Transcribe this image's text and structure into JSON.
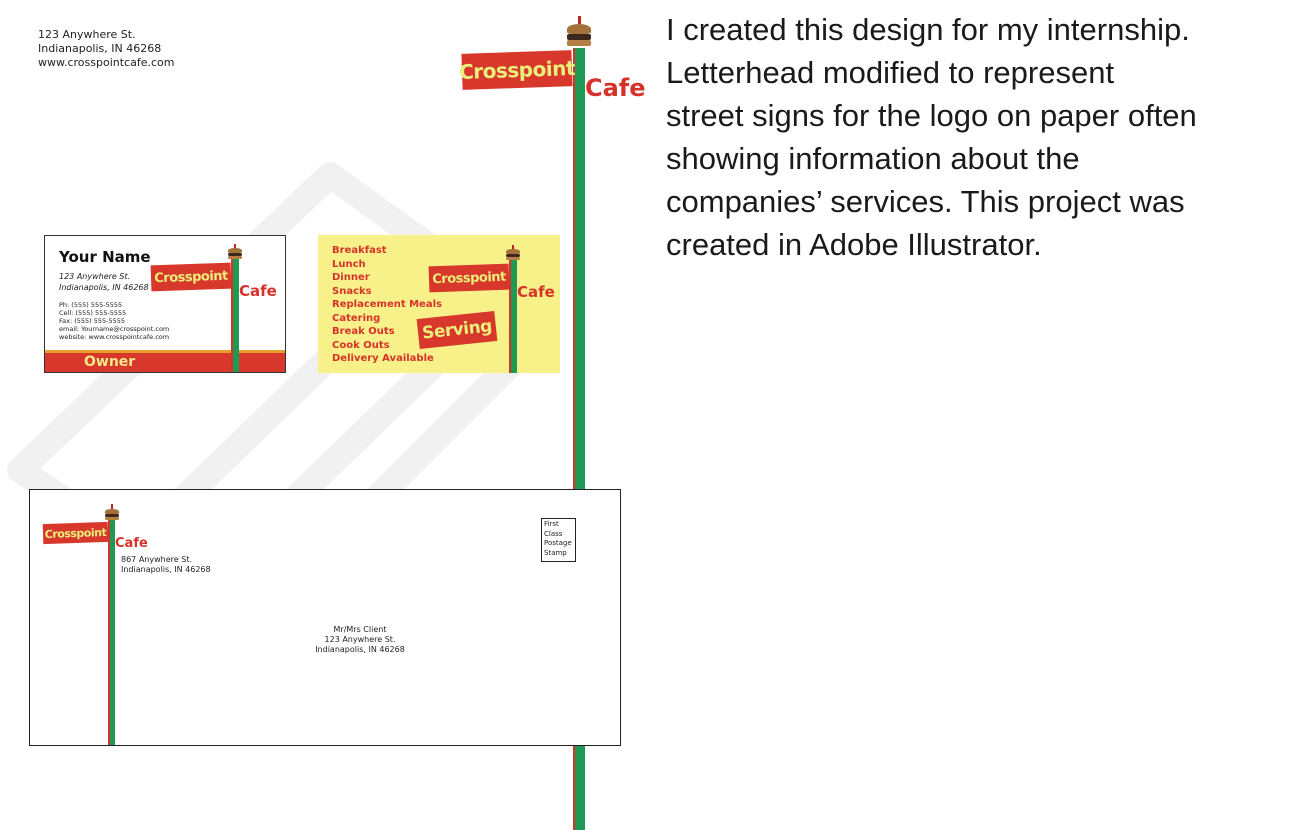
{
  "letterhead": {
    "address_line1": "123 Anywhere St.",
    "address_line2": "Indianapolis, IN 46268",
    "website": "www.crosspointcafe.com",
    "logo_sign": "Crosspoint",
    "logo_cafe": "Cafe"
  },
  "business_card_front": {
    "name": "Your Name",
    "address_line1": "123 Anywhere St.",
    "address_line2": "Indianapolis, IN 46268",
    "phone": "Ph: (555) 555-5555",
    "cell": "Cell: (555) 555-5555",
    "fax": "Fax: (555) 555-5555",
    "email": "email: Yourname@crosspoint.com",
    "website": "website: www.crosspointcafe.com",
    "logo_sign": "Crosspoint",
    "logo_cafe": "Cafe",
    "title": "Owner"
  },
  "business_card_back": {
    "services": [
      "Breakfast",
      "Lunch",
      "Dinner",
      "Snacks",
      "Replacement Meals",
      "Catering",
      "Break Outs",
      "Cook Outs",
      "Delivery Available"
    ],
    "logo_sign": "Crosspoint",
    "logo_cafe": "Cafe",
    "serving_sign": "Serving"
  },
  "envelope": {
    "logo_sign": "Crosspoint",
    "logo_cafe": "Cafe",
    "return_line1": "867 Anywhere St.",
    "return_line2": "Indianapolis, IN 46268",
    "recipient_line1": "Mr/Mrs Client",
    "recipient_line2": "123 Anywhere St.",
    "recipient_line3": "Indianapolis, IN 46268",
    "stamp_lines": [
      "First",
      "Class",
      "Postage",
      "Stamp"
    ]
  },
  "description": {
    "lines": [
      "I created this design for my internship.",
      "Letterhead modified to represent",
      "street signs for the logo on paper often",
      "showing information about the",
      "companies’ services.  This project was",
      "created in Adobe Illustrator."
    ]
  },
  "colors": {
    "sign_red": "#d8372b",
    "sign_text": "#e9ef7a",
    "pole_green": "#1f9a55",
    "card_yellow": "#f8f18a",
    "cafe_red": "#d6322a"
  }
}
